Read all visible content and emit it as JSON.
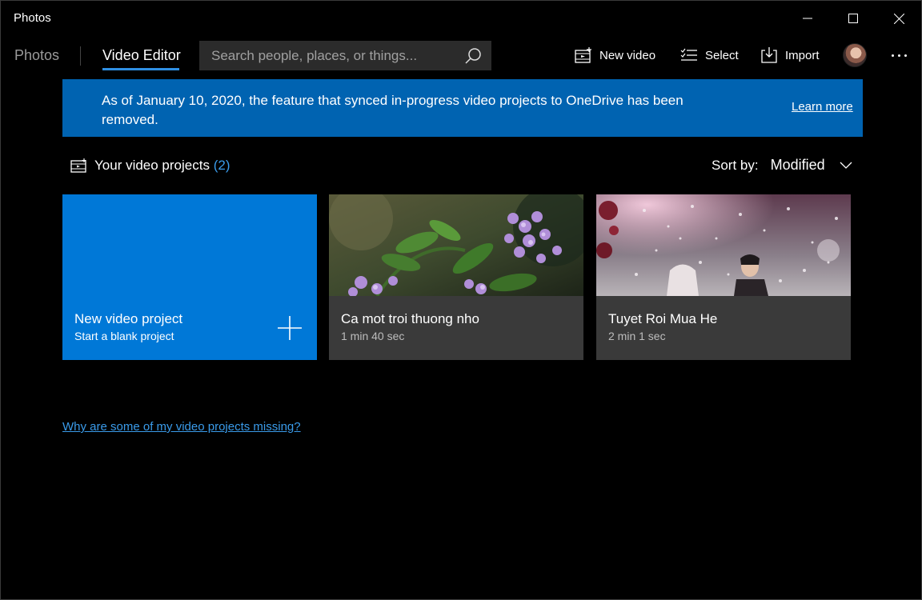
{
  "window": {
    "title": "Photos"
  },
  "nav": {
    "tabs": [
      {
        "label": "Photos"
      },
      {
        "label": "Video Editor"
      }
    ],
    "search_placeholder": "Search people, places, or things...",
    "commands": {
      "new_video": "New video",
      "select": "Select",
      "import": "Import"
    }
  },
  "banner": {
    "message": "As of January 10, 2020, the feature that synced in-progress video projects to OneDrive has been removed.",
    "link": "Learn more"
  },
  "projects": {
    "heading": "Your video projects",
    "count": "(2)",
    "sort_label": "Sort by:",
    "sort_value": "Modified",
    "cards": [
      {
        "title": "New video project",
        "subtitle": "Start a blank project"
      },
      {
        "title": "Ca mot troi thuong nho",
        "subtitle": "1 min 40 sec"
      },
      {
        "title": "Tuyet Roi Mua He",
        "subtitle": "2 min 1 sec"
      }
    ]
  },
  "footer_link": "Why are some of my video projects missing?",
  "colors": {
    "accent": "#0078d7",
    "banner": "#0063b1",
    "link": "#3a9bea",
    "background": "#000000",
    "card": "#3a3a3a"
  },
  "icons": [
    "minimize-icon",
    "maximize-icon",
    "close-icon",
    "search-icon",
    "new-video-icon",
    "select-icon",
    "import-icon",
    "more-icon",
    "video-projects-icon",
    "chevron-down-icon",
    "plus-icon"
  ]
}
